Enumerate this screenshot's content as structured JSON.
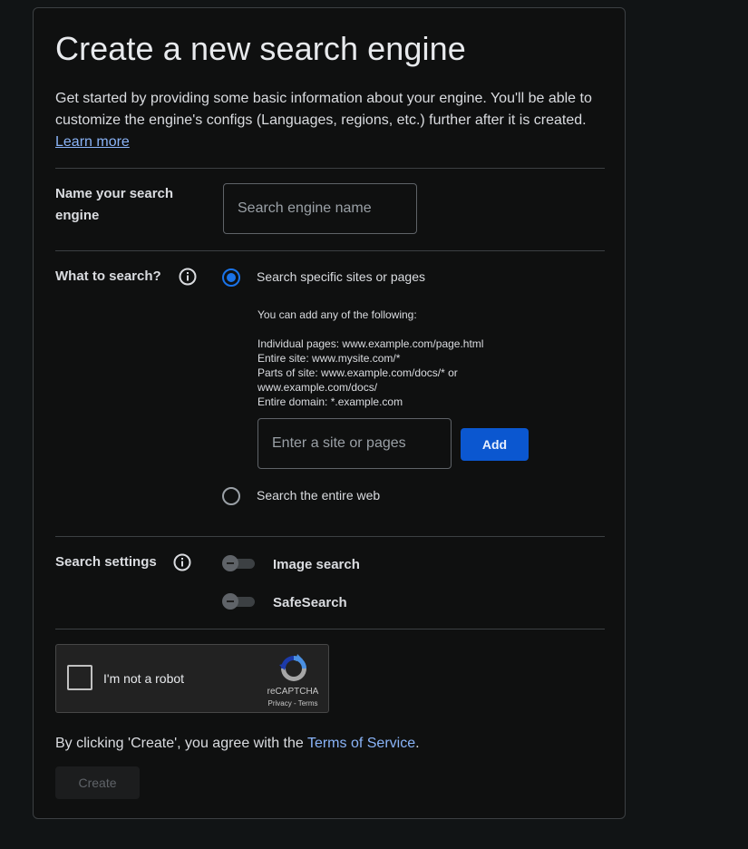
{
  "page": {
    "title": "Create a new search engine",
    "intro": "Get started by providing some basic information about your engine. You'll be able to customize the engine's configs (Languages, regions, etc.) further after it is created.",
    "learn_more": "Learn more"
  },
  "name_section": {
    "label": "Name your search engine",
    "placeholder": "Search engine name",
    "value": ""
  },
  "what_section": {
    "label": "What to search?",
    "info_icon": "info-icon",
    "option_specific": "Search specific sites or pages",
    "option_specific_selected": true,
    "hint_title": "You can add any of the following:",
    "hint_lines": [
      "Individual pages: www.example.com/page.html",
      "Entire site: www.mysite.com/*",
      "Parts of site: www.example.com/docs/* or",
      "www.example.com/docs/",
      "Entire domain: *.example.com"
    ],
    "site_placeholder": "Enter a site or pages",
    "site_value": "",
    "add_button": "Add",
    "option_web": "Search the entire web",
    "option_web_selected": false
  },
  "settings_section": {
    "label": "Search settings",
    "info_icon": "info-icon",
    "image_search": "Image search",
    "image_search_on": false,
    "safesearch": "SafeSearch",
    "safesearch_on": false
  },
  "recaptcha": {
    "label": "I'm not a robot",
    "brand": "reCAPTCHA",
    "links": "Privacy - Terms"
  },
  "footer": {
    "terms_prefix": "By clicking 'Create', you agree with the ",
    "terms_link": "Terms of Service",
    "terms_suffix": ".",
    "create_button": "Create"
  },
  "colors": {
    "accent": "#1a73e8",
    "button_blue": "#0b57d0",
    "link": "#8ab4f8",
    "background": "#0f1010"
  }
}
